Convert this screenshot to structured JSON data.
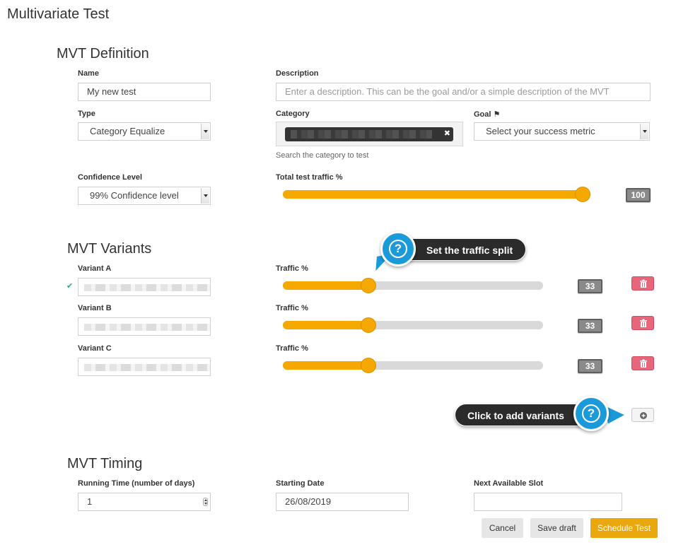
{
  "page": {
    "title": "Multivariate Test"
  },
  "definition": {
    "title": "MVT Definition",
    "name": {
      "label": "Name",
      "value": "My new test"
    },
    "description": {
      "label": "Description",
      "placeholder": "Enter a description. This can be the goal and/or a simple description of the MVT"
    },
    "type": {
      "label": "Type",
      "value": "Category Equalize"
    },
    "category": {
      "label": "Category",
      "hint": "Search the category to test",
      "remove_glyph": "✖"
    },
    "goal": {
      "label": "Goal",
      "flag_glyph": "⚑",
      "value": "Select your success metric"
    },
    "confidence": {
      "label": "Confidence Level",
      "value": "99% Confidence level"
    },
    "traffic": {
      "label": "Total test traffic %",
      "value": "100",
      "level": 100
    }
  },
  "variants": {
    "title": "MVT Variants",
    "check_glyph": "✔",
    "traffic_label": "Traffic %",
    "items": [
      {
        "label": "Variant A",
        "traffic": "33",
        "level": 33
      },
      {
        "label": "Variant B",
        "traffic": "33",
        "level": 33
      },
      {
        "label": "Variant C",
        "traffic": "33",
        "level": 33
      }
    ]
  },
  "callouts": {
    "traffic_split": "Set the traffic split",
    "add_variants": "Click to add variants",
    "question_glyph": "?"
  },
  "timing": {
    "title": "MVT Timing",
    "running_time": {
      "label": "Running Time (number of days)",
      "value": "1"
    },
    "starting_date": {
      "label": "Starting Date",
      "value": "26/08/2019"
    },
    "next_slot": {
      "label": "Next Available Slot",
      "value": ""
    }
  },
  "actions": {
    "cancel": "Cancel",
    "save_draft": "Save draft",
    "schedule": "Schedule Test"
  },
  "colors": {
    "accent": "#f5a800",
    "primary_button": "#eaa80e",
    "delete_button": "#e8667c",
    "callout_blue": "#1a9ad9",
    "callout_dark": "#2b2b2b"
  }
}
